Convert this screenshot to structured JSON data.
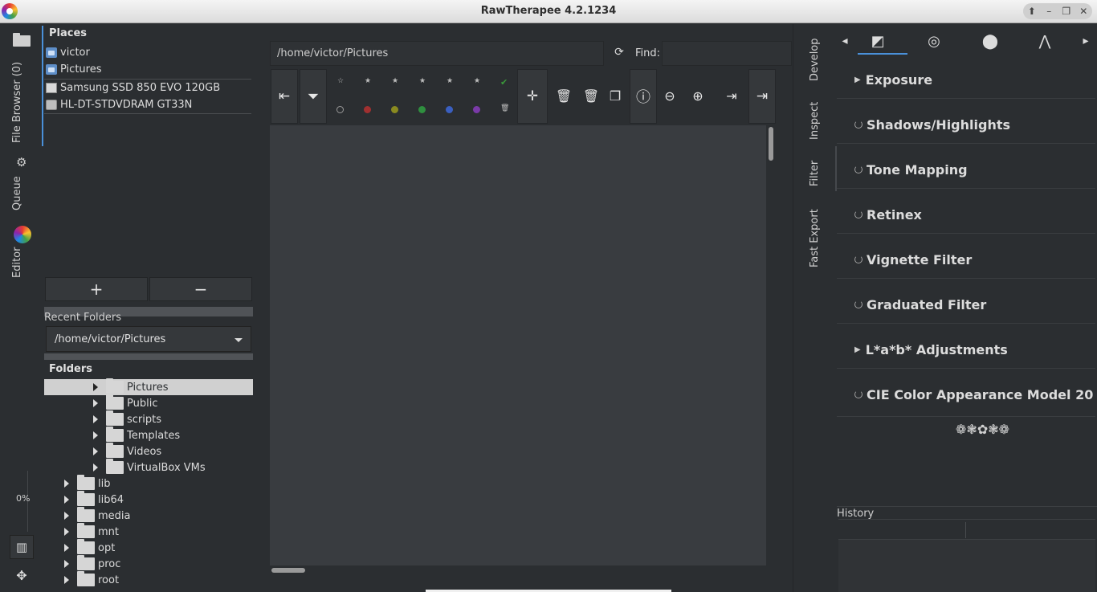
{
  "window": {
    "title": "RawTherapee 4.2.1234"
  },
  "left_tabs": {
    "file_browser": "File Browser (0)",
    "queue": "Queue",
    "editor": "Editor",
    "progress": "0%"
  },
  "places": {
    "heading": "Places",
    "items": [
      {
        "label": "victor",
        "icon": "home-folder-icon"
      },
      {
        "label": "Pictures",
        "icon": "pictures-folder-icon"
      },
      {
        "label": "Samsung SSD 850 EVO 120GB",
        "icon": "drive-icon"
      },
      {
        "label": "HL-DT-STDVDRAM GT33N",
        "icon": "cdrom-icon"
      }
    ],
    "add_label": "+",
    "remove_label": "−"
  },
  "recent": {
    "label": "Recent Folders",
    "value": "/home/victor/Pictures"
  },
  "folders": {
    "heading": "Folders",
    "rows": [
      {
        "label": "Pictures",
        "selected": true
      },
      {
        "label": "Public"
      },
      {
        "label": "scripts"
      },
      {
        "label": "Templates"
      },
      {
        "label": "Videos"
      },
      {
        "label": "VirtualBox VMs"
      },
      {
        "label": "lib"
      },
      {
        "label": "lib64"
      },
      {
        "label": "media"
      },
      {
        "label": "mnt"
      },
      {
        "label": "opt"
      },
      {
        "label": "proc"
      },
      {
        "label": "root"
      }
    ]
  },
  "browser": {
    "path": "/home/victor/Pictures",
    "find_label": "Find:",
    "find_value": ""
  },
  "toolbar": {
    "stars": [
      "☆",
      "★",
      "★",
      "★",
      "★",
      "★"
    ],
    "color_dots": [
      "#2b2e31",
      "#a03030",
      "#8a8a20",
      "#2f8f3f",
      "#3a5fc0",
      "#7a3aa8"
    ],
    "check": "✔",
    "trash_small": "🗑"
  },
  "right_tabs": {
    "develop": "Develop",
    "inspect": "Inspect",
    "filter": "Filter",
    "fast_export": "Fast Export"
  },
  "tool_tabs": {
    "nav_left": "◂",
    "nav_right": "▸"
  },
  "tools": [
    {
      "label": "Exposure",
      "kind": "expander"
    },
    {
      "label": "Shadows/Highlights",
      "kind": "power"
    },
    {
      "label": "Tone Mapping",
      "kind": "power"
    },
    {
      "label": "Retinex",
      "kind": "power"
    },
    {
      "label": "Vignette Filter",
      "kind": "power"
    },
    {
      "label": "Graduated Filter",
      "kind": "power"
    },
    {
      "label": "L*a*b* Adjustments",
      "kind": "expander"
    },
    {
      "label": "CIE Color Appearance Model 20",
      "kind": "power"
    }
  ],
  "ornament": "❁❃✿❃❁",
  "history": {
    "label": "History"
  }
}
